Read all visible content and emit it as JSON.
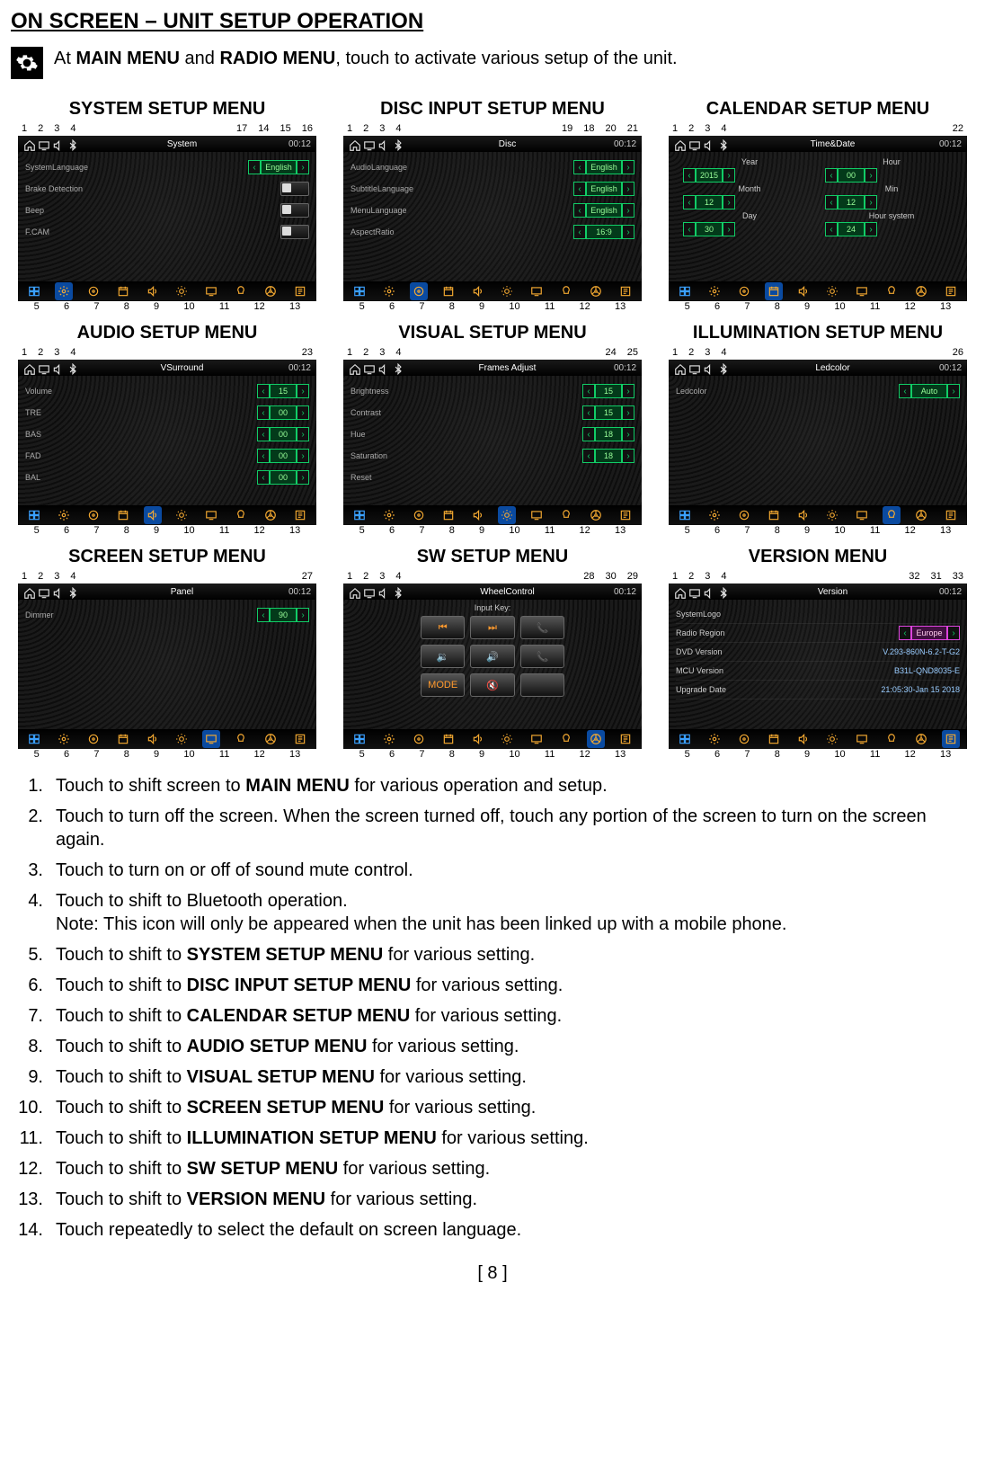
{
  "heading": "ON SCREEN – UNIT SETUP OPERATION",
  "intro": {
    "pre": "At ",
    "b1": "MAIN MENU",
    "mid": " and ",
    "b2": "RADIO MENU",
    "post": ", touch to activate various setup of the unit."
  },
  "titles": {
    "system": "SYSTEM SETUP MENU",
    "disc": "DISC INPUT SETUP MENU",
    "calendar": "CALENDAR SETUP MENU",
    "audio": "AUDIO SETUP MENU",
    "visual": "VISUAL SETUP MENU",
    "illum": "ILLUMINATION SETUP MENU",
    "screen": "SCREEN SETUP MENU",
    "sw": "SW SETUP MENU",
    "version": "VERSION MENU"
  },
  "topbar": {
    "clock": "00:12"
  },
  "screens": {
    "system": {
      "title": "System",
      "rows": [
        {
          "label": "SystemLanguage",
          "value": "English"
        },
        {
          "label": "Brake Detection",
          "toggle": true
        },
        {
          "label": "Beep",
          "toggle": true
        },
        {
          "label": "F.CAM",
          "toggle": true
        }
      ],
      "topnums": [
        "1",
        "2",
        "3",
        "4",
        "17",
        "14",
        "15",
        "16"
      ]
    },
    "disc": {
      "title": "Disc",
      "rows": [
        {
          "label": "AudioLanguage",
          "value": "English"
        },
        {
          "label": "SubtitleLanguage",
          "value": "English"
        },
        {
          "label": "MenuLanguage",
          "value": "English"
        },
        {
          "label": "AspectRatio",
          "value": "16:9"
        }
      ],
      "topnums": [
        "1",
        "2",
        "3",
        "4",
        "19",
        "18",
        "20",
        "21"
      ]
    },
    "calendar": {
      "title": "Time&Date",
      "cols": [
        {
          "header": "Year",
          "value": "2015"
        },
        {
          "header": "Hour",
          "value": "00"
        },
        {
          "header": "Month",
          "value": "12"
        },
        {
          "header": "Min",
          "value": "12"
        },
        {
          "header": "Day",
          "value": "30"
        },
        {
          "header": "Hour system",
          "value": "24"
        }
      ],
      "topnums": [
        "1",
        "2",
        "3",
        "4",
        "22"
      ]
    },
    "audio": {
      "title": "VSurround",
      "rows": [
        {
          "label": "Volume",
          "value": "15"
        },
        {
          "label": "TRE",
          "value": "00"
        },
        {
          "label": "BAS",
          "value": "00"
        },
        {
          "label": "FAD",
          "value": "00"
        },
        {
          "label": "BAL",
          "value": "00"
        }
      ],
      "topnums": [
        "1",
        "2",
        "3",
        "4",
        "23"
      ]
    },
    "visual": {
      "title": "Frames Adjust",
      "rows": [
        {
          "label": "Brightness",
          "value": "15"
        },
        {
          "label": "Contrast",
          "value": "15"
        },
        {
          "label": "Hue",
          "value": "18"
        },
        {
          "label": "Saturation",
          "value": "18"
        },
        {
          "label": "Reset",
          "value": ""
        }
      ],
      "topnums": [
        "1",
        "2",
        "3",
        "4",
        "24",
        "25"
      ]
    },
    "illum": {
      "title": "Ledcolor",
      "rows": [
        {
          "label": "Ledcolor",
          "value": "Auto"
        }
      ],
      "topnums": [
        "1",
        "2",
        "3",
        "4",
        "26"
      ]
    },
    "screen": {
      "title": "Panel",
      "rows": [
        {
          "label": "Dimmer",
          "value": "90"
        }
      ],
      "topnums": [
        "1",
        "2",
        "3",
        "4",
        "27"
      ]
    },
    "sw": {
      "title": "WheelControl",
      "inputkey": "Input Key:",
      "buttons": [
        "⏮",
        "⏭",
        "📞",
        "🔉",
        "🔊",
        "📞",
        "MODE",
        "🔇",
        ""
      ],
      "topnums": [
        "1",
        "2",
        "3",
        "4",
        "28",
        "30",
        "29"
      ]
    },
    "version": {
      "title": "Version",
      "rows": [
        {
          "label": "SystemLogo",
          "value": ""
        },
        {
          "label": "Radio Region",
          "value": "Europe"
        },
        {
          "label": "DVD Version",
          "value": "V.293-860N-6.2-T-G2"
        },
        {
          "label": "MCU Version",
          "value": "B31L-QND8035-E"
        },
        {
          "label": "Upgrade Date",
          "value": "21:05:30-Jan 15 2018"
        }
      ],
      "topnums": [
        "1",
        "2",
        "3",
        "4",
        "32",
        "31",
        "33"
      ]
    }
  },
  "bottomnums": [
    "5",
    "6",
    "7",
    "8",
    "9",
    "10",
    "11",
    "12",
    "13"
  ],
  "bottomicons": [
    "win",
    "sys",
    "disc",
    "cal",
    "aud",
    "vis",
    "scr",
    "ill",
    "sw",
    "ver"
  ],
  "instructions": [
    {
      "n": "1.",
      "pre": "Touch to shift screen to ",
      "b": "MAIN MENU",
      "post": " for various operation and setup."
    },
    {
      "n": "2.",
      "pre": "Touch to turn off the screen. When the screen turned off, touch any portion of the screen to turn on the screen again.",
      "b": "",
      "post": ""
    },
    {
      "n": "3.",
      "pre": "Touch to turn on or off of sound mute control.",
      "b": "",
      "post": ""
    },
    {
      "n": "4.",
      "pre": "Touch to shift to Bluetooth operation.",
      "b": "",
      "post": "",
      "note": "Note: This icon will only be appeared when the unit has been linked up with a mobile phone."
    },
    {
      "n": "5.",
      "pre": "Touch to shift to ",
      "b": "SYSTEM SETUP MENU",
      "post": " for various setting."
    },
    {
      "n": "6.",
      "pre": "Touch to shift to ",
      "b": "DISC INPUT SETUP MENU",
      "post": " for various setting."
    },
    {
      "n": "7.",
      "pre": "Touch to shift to ",
      "b": "CALENDAR SETUP MENU",
      "post": " for various setting."
    },
    {
      "n": "8.",
      "pre": "Touch to shift to ",
      "b": "AUDIO SETUP MENU",
      "post": " for various setting."
    },
    {
      "n": "9.",
      "pre": "Touch to shift to ",
      "b": "VISUAL SETUP MENU",
      "post": " for various setting."
    },
    {
      "n": "10.",
      "pre": "Touch to shift to ",
      "b": "SCREEN SETUP MENU",
      "post": " for various setting."
    },
    {
      "n": "11.",
      "pre": "Touch to shift to ",
      "b": "ILLUMINATION SETUP MENU",
      "post": " for various setting."
    },
    {
      "n": "12.",
      "pre": "Touch to shift to ",
      "b": "SW SETUP MENU",
      "post": " for various setting."
    },
    {
      "n": "13.",
      "pre": "Touch to shift to ",
      "b": "VERSION MENU",
      "post": " for various setting."
    },
    {
      "n": "14.",
      "pre": "Touch repeatedly to select the default on screen language.",
      "b": "",
      "post": ""
    }
  ],
  "pagenum": "[ 8 ]"
}
